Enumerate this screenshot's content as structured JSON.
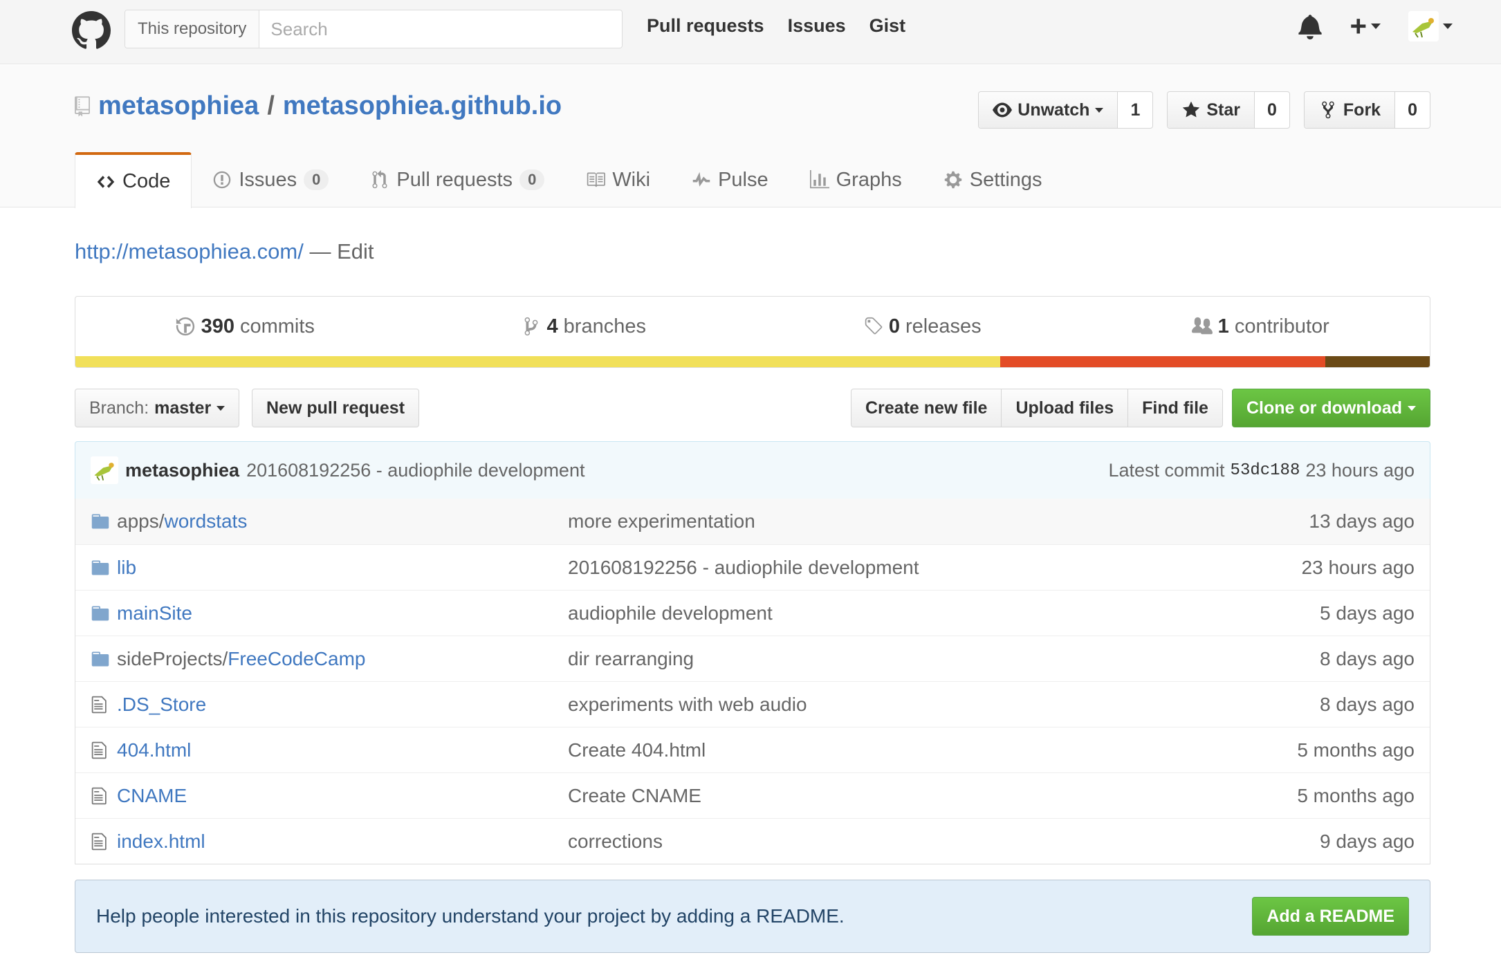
{
  "header": {
    "scope_label": "This repository",
    "search_placeholder": "Search",
    "nav": [
      "Pull requests",
      "Issues",
      "Gist"
    ]
  },
  "repo": {
    "owner": "metasophiea",
    "separator": "/",
    "name": "metasophiea.github.io",
    "watch": {
      "label": "Unwatch",
      "count": "1"
    },
    "star": {
      "label": "Star",
      "count": "0"
    },
    "fork": {
      "label": "Fork",
      "count": "0"
    }
  },
  "tabs": [
    {
      "label": "Code",
      "icon": "code-icon"
    },
    {
      "label": "Issues",
      "count": "0",
      "icon": "issue-icon"
    },
    {
      "label": "Pull requests",
      "count": "0",
      "icon": "pull-request-icon"
    },
    {
      "label": "Wiki",
      "icon": "book-icon"
    },
    {
      "label": "Pulse",
      "icon": "pulse-icon"
    },
    {
      "label": "Graphs",
      "icon": "graph-icon"
    },
    {
      "label": "Settings",
      "icon": "gear-icon"
    }
  ],
  "description": {
    "url": "http://metasophiea.com/",
    "edit": " — Edit"
  },
  "summary": {
    "commits": {
      "num": "390",
      "label": "commits"
    },
    "branches": {
      "num": "4",
      "label": "branches"
    },
    "releases": {
      "num": "0",
      "label": "releases"
    },
    "contributors": {
      "num": "1",
      "label": "contributor"
    }
  },
  "languages": [
    {
      "color": "#f1e05a",
      "percent": 68.3
    },
    {
      "color": "#e34c26",
      "percent": 24.0
    },
    {
      "color": "#6b4a16",
      "percent": 7.7
    }
  ],
  "file_nav": {
    "branch_label": "Branch:",
    "branch_name": "master",
    "new_pr": "New pull request",
    "create_file": "Create new file",
    "upload_files": "Upload files",
    "find_file": "Find file",
    "clone": "Clone or download"
  },
  "latest_commit": {
    "author": "metasophiea",
    "message": "201608192256 - audiophile development",
    "prefix": "Latest commit",
    "sha": "53dc188",
    "age": "23 hours ago"
  },
  "files": [
    {
      "type": "dir",
      "path": "apps/",
      "name": "wordstats",
      "message": "more experimentation",
      "age": "13 days ago"
    },
    {
      "type": "dir",
      "path": "",
      "name": "lib",
      "message": "201608192256 - audiophile development",
      "age": "23 hours ago"
    },
    {
      "type": "dir",
      "path": "",
      "name": "mainSite",
      "message": "audiophile development",
      "age": "5 days ago"
    },
    {
      "type": "dir",
      "path": "sideProjects/",
      "name": "FreeCodeCamp",
      "message": "dir rearranging",
      "age": "8 days ago"
    },
    {
      "type": "file",
      "path": "",
      "name": ".DS_Store",
      "message": "experiments with web audio",
      "age": "8 days ago"
    },
    {
      "type": "file",
      "path": "",
      "name": "404.html",
      "message": "Create 404.html",
      "age": "5 months ago"
    },
    {
      "type": "file",
      "path": "",
      "name": "CNAME",
      "message": "Create CNAME",
      "age": "5 months ago"
    },
    {
      "type": "file",
      "path": "",
      "name": "index.html",
      "message": "corrections",
      "age": "9 days ago"
    }
  ],
  "readme": {
    "text": "Help people interested in this repository understand your project by adding a README.",
    "button": "Add a README"
  }
}
